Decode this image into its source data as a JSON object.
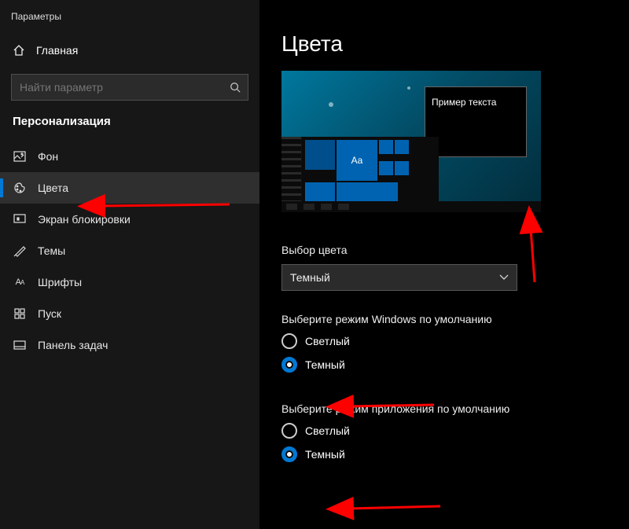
{
  "window_title": "Параметры",
  "home_label": "Главная",
  "search_placeholder": "Найти параметр",
  "section": "Персонализация",
  "nav": {
    "background": "Фон",
    "colors": "Цвета",
    "lockscreen": "Экран блокировки",
    "themes": "Темы",
    "fonts": "Шрифты",
    "start": "Пуск",
    "taskbar": "Панель задач"
  },
  "heading": "Цвета",
  "preview_sample_text": "Пример текста",
  "preview_aa": "Aa",
  "color_choice": {
    "label": "Выбор цвета",
    "value": "Темный"
  },
  "windows_mode": {
    "label": "Выберите режим Windows по умолчанию",
    "light": "Светлый",
    "dark": "Темный",
    "selected": "dark"
  },
  "app_mode": {
    "label": "Выберите режим приложения по умолчанию",
    "light": "Светлый",
    "dark": "Темный",
    "selected": "dark"
  }
}
